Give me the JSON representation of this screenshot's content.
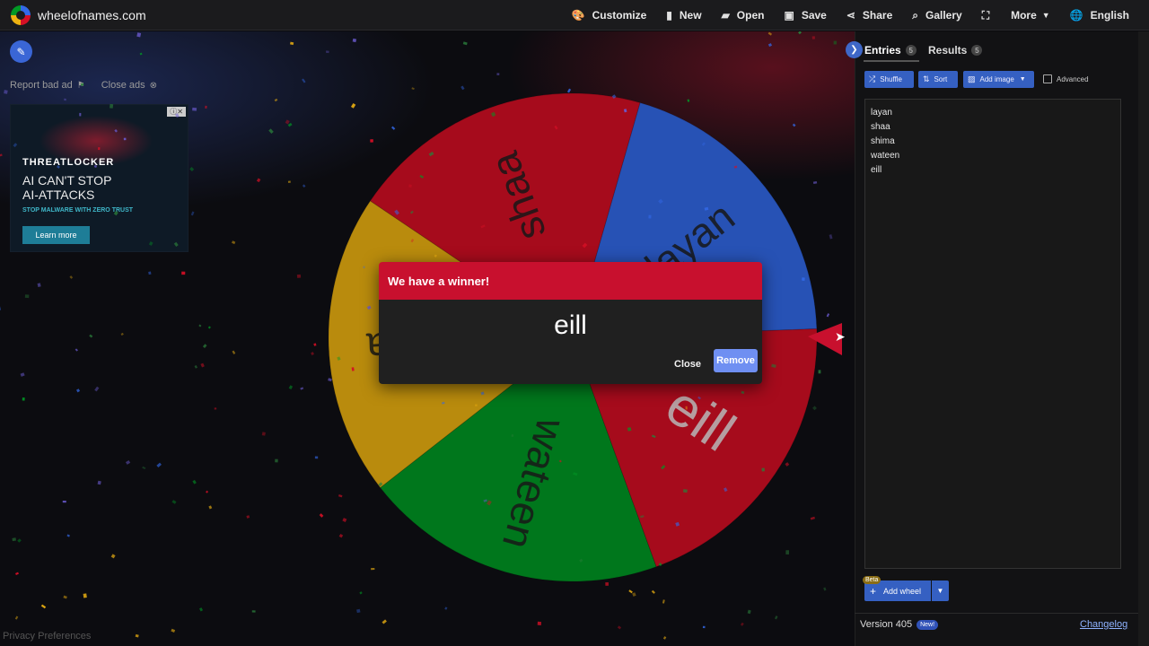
{
  "header": {
    "site_name": "wheelofnames.com",
    "nav": [
      {
        "label": "Customize",
        "icon": "palette-icon"
      },
      {
        "label": "New",
        "icon": "file-icon"
      },
      {
        "label": "Open",
        "icon": "folder-open-icon"
      },
      {
        "label": "Save",
        "icon": "floppy-disk-icon"
      },
      {
        "label": "Share",
        "icon": "share-icon"
      },
      {
        "label": "Gallery",
        "icon": "search-icon"
      },
      {
        "label": "More",
        "icon": "chevron-down-icon"
      },
      {
        "label": "English",
        "icon": "globe-icon"
      }
    ]
  },
  "ad": {
    "report_label": "Report bad ad",
    "close_label": "Close ads",
    "tag": "ⓘ✕",
    "brand": "THREATLOCKER",
    "headline_1": "AI CAN'T STOP",
    "headline_2": "AI-ATTACKS",
    "sub": "STOP MALWARE WITH ZERO TRUST",
    "cta": "Learn more"
  },
  "wheel": {
    "segments": [
      {
        "label": "layan",
        "color": "#3369e8"
      },
      {
        "label": "eill",
        "color": "#d50f25"
      },
      {
        "label": "wateen",
        "color": "#009925"
      },
      {
        "label": "shima",
        "color": "#eeb211"
      },
      {
        "label": "shaa",
        "color": "#d50f25"
      }
    ]
  },
  "dialog": {
    "title": "We have a winner!",
    "winner": "eill",
    "close_label": "Close",
    "remove_label": "Remove"
  },
  "panel": {
    "tabs": {
      "entries_label": "Entries",
      "entries_count": "5",
      "results_label": "Results",
      "results_count": "5"
    },
    "toolbar": {
      "shuffle_label": "Shuffle",
      "sort_label": "Sort",
      "add_image_label": "Add image",
      "advanced_label": "Advanced"
    },
    "entries": [
      "layan",
      "shaa",
      "shima",
      "wateen",
      "eill"
    ],
    "beta_label": "Beta",
    "add_wheel_label": "Add wheel",
    "version_label": "Version 405",
    "new_badge": "New!",
    "changelog_label": "Changelog"
  },
  "footer": {
    "privacy_label": "Privacy Preferences"
  },
  "colors": {
    "accent_blue": "#3560c2",
    "winner_red": "#c8102e",
    "remove_button": "#6f8ff2"
  }
}
